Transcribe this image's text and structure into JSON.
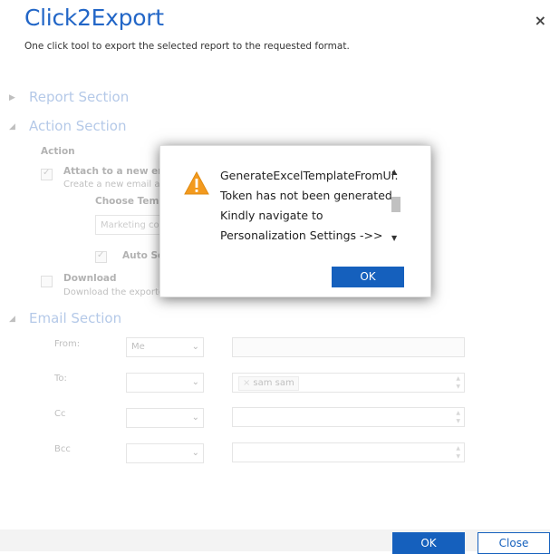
{
  "app": {
    "title": "Click2Export",
    "subtitle": "One click tool to export the selected report to the requested format.",
    "close_glyph": "×"
  },
  "sections": {
    "report": "Report Section",
    "action": "Action Section",
    "email": "Email Section"
  },
  "action": {
    "label": "Action",
    "attach_title": "Attach to a new ema",
    "attach_desc": "Create a new email an",
    "choose_template": "Choose Templ",
    "template_value": "Marketing co",
    "auto_send": "Auto Se",
    "download_title": "Download",
    "download_desc": "Download the exporte"
  },
  "email": {
    "from_label": "From:",
    "from_value": "Me",
    "to_label": "To:",
    "to_tag": "sam sam",
    "cc_label": "Cc",
    "bcc_label": "Bcc"
  },
  "dialog": {
    "message": "GenerateExcelTemplateFromUI: Token has not been generated. Kindly navigate to Personalization Settings ->> ",
    "ok": "OK"
  },
  "footer": {
    "ok": "OK",
    "close": "Close"
  },
  "colors": {
    "accent": "#1560bd",
    "title": "#2266c7",
    "warning": "#f39a1e"
  }
}
